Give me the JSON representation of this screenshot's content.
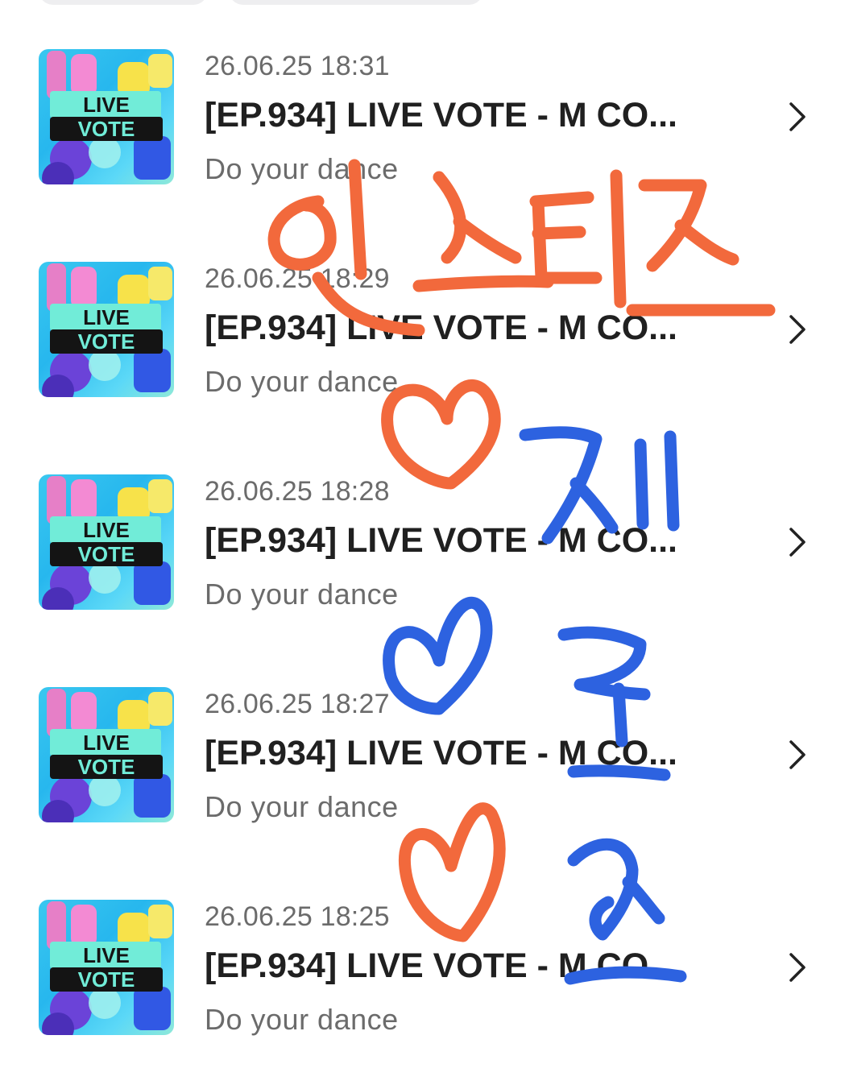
{
  "colors": {
    "scribble_orange": "#f2693c",
    "scribble_blue": "#2d62e0",
    "thumb_bg": "#2fbdf0",
    "thumb_band": "#6ee9d8",
    "text_primary": "#202020",
    "text_secondary": "#6b6b6b"
  },
  "items": [
    {
      "time": "26.06.25 18:31",
      "title": "[EP.934] LIVE VOTE - M CO...",
      "subtitle": "Do your dance",
      "thumb": {
        "line1": "LIVE",
        "line2": "VOTE"
      },
      "icon": "chevron-right-icon"
    },
    {
      "time": "26.06.25 18:29",
      "title": "[EP.934] LIVE VOTE - M CO...",
      "subtitle": "Do your dance",
      "thumb": {
        "line1": "LIVE",
        "line2": "VOTE"
      },
      "icon": "chevron-right-icon"
    },
    {
      "time": "26.06.25 18:28",
      "title": "[EP.934] LIVE VOTE - M CO...",
      "subtitle": "Do your dance",
      "thumb": {
        "line1": "LIVE",
        "line2": "VOTE"
      },
      "icon": "chevron-right-icon"
    },
    {
      "time": "26.06.25 18:27",
      "title": "[EP.934] LIVE VOTE - M CO...",
      "subtitle": "Do your dance",
      "thumb": {
        "line1": "LIVE",
        "line2": "VOTE"
      },
      "icon": "chevron-right-icon"
    },
    {
      "time": "26.06.25 18:25",
      "title": "[EP.934] LIVE VOTE - M CO...",
      "subtitle": "Do your dance",
      "thumb": {
        "line1": "LIVE",
        "line2": "VOTE"
      },
      "icon": "chevron-right-icon"
    }
  ],
  "annotations": {
    "handwriting_1": "민스티즈",
    "handwriting_2": "재",
    "handwriting_3": "률",
    "handwriting_4": "ㅅ"
  }
}
